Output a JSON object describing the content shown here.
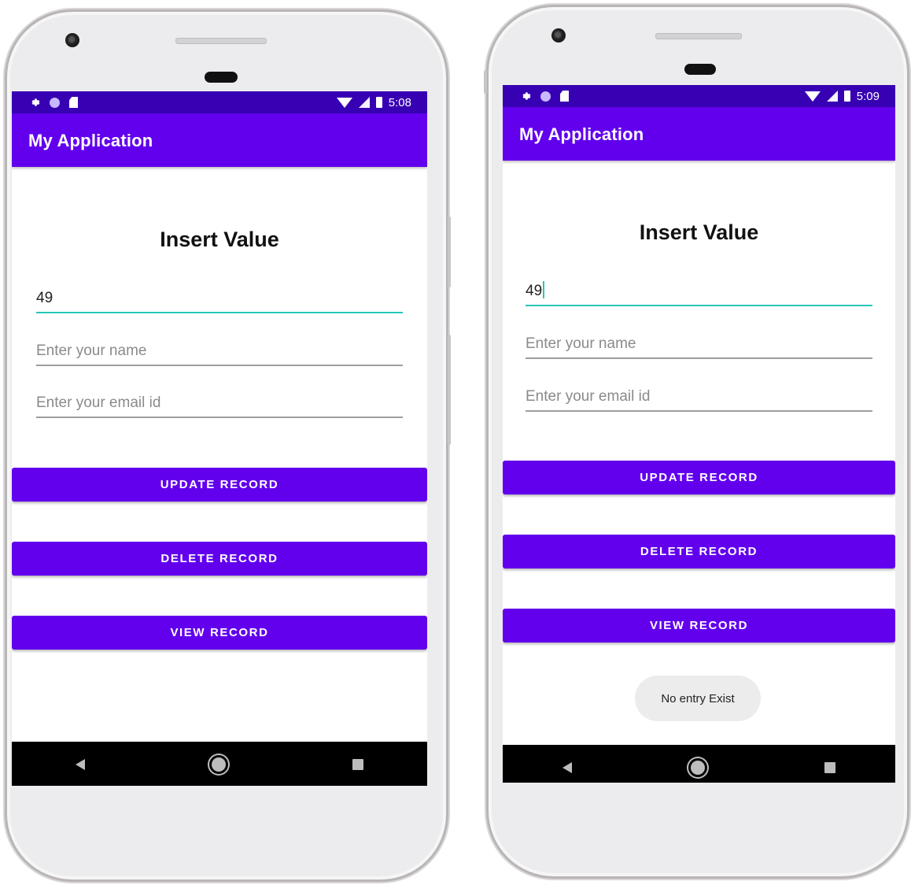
{
  "colors": {
    "status_bar": "#3700b3",
    "app_bar": "#6200ee",
    "button": "#6200ee",
    "focus_underline": "#26c6b8"
  },
  "screens": [
    {
      "status_time": "5:08",
      "app_title": "My Application",
      "heading": "Insert Value",
      "id_value": "49",
      "name_placeholder": "Enter your name",
      "email_placeholder": "Enter your email id",
      "update_label": "UPDATE RECORD",
      "delete_label": "DELETE RECORD",
      "view_label": "VIEW RECORD"
    },
    {
      "status_time": "5:09",
      "app_title": "My Application",
      "heading": "Insert Value",
      "id_value": "49",
      "name_placeholder": "Enter your name",
      "email_placeholder": "Enter your email id",
      "update_label": "UPDATE RECORD",
      "delete_label": "DELETE RECORD",
      "view_label": "VIEW RECORD",
      "toast": "No entry Exist"
    }
  ]
}
